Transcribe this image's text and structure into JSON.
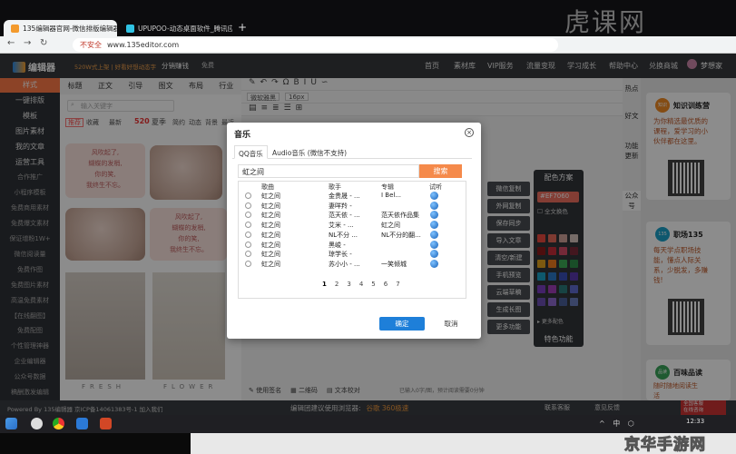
{
  "browser": {
    "tabs": [
      {
        "title": "135编辑器官网-微信排版编辑器",
        "active": true
      },
      {
        "title": "UPUPOO-动态桌面软件_腾讯应",
        "active": false
      }
    ],
    "new_tab": "+",
    "insecure_label": "不安全",
    "url": "www.135editor.com",
    "watermark_top": "虎课网"
  },
  "site_header": {
    "logo": "编辑器",
    "info": "520W式上架 | 好看好想动态字",
    "fans": "分销赚钱",
    "free": "免费",
    "nav": [
      "首页",
      "素材库",
      "VIP服务",
      "流量变现",
      "学习成长",
      "帮助中心",
      "兑换商城"
    ],
    "user": "梦想家"
  },
  "left_sidebar": {
    "items": [
      {
        "label": "样式",
        "strong": true,
        "active": true
      },
      {
        "label": "一键排版",
        "strong": true
      },
      {
        "label": "模板",
        "strong": true
      },
      {
        "label": "图片素材",
        "strong": true
      },
      {
        "label": "我的文章",
        "strong": true
      },
      {
        "label": "运营工具",
        "strong": true
      },
      {
        "label": "合作推广",
        "strong": false
      },
      {
        "label": "小程序模板",
        "strong": false
      },
      {
        "label": "免费商用素材",
        "strong": false
      },
      {
        "label": "免费爆文素材",
        "strong": false
      },
      {
        "label": "保证增粉1W+",
        "strong": false
      },
      {
        "label": "微信阅读量",
        "strong": false
      },
      {
        "label": "免费作图",
        "strong": false
      },
      {
        "label": "免费图片素材",
        "strong": false
      },
      {
        "label": "高温免费素材",
        "strong": false
      },
      {
        "label": "【在线翻图】",
        "strong": false
      },
      {
        "label": "免费配图",
        "strong": false
      },
      {
        "label": "个性管理神器",
        "strong": false
      },
      {
        "label": "企业编辑器",
        "strong": false
      },
      {
        "label": "公众号数据",
        "strong": false
      },
      {
        "label": "稿酬激发编辑",
        "strong": false
      }
    ]
  },
  "left_panel": {
    "tabs": [
      "标题",
      "正文",
      "引导",
      "图文",
      "布局",
      "行业"
    ],
    "search_placeholder": "输入关键字",
    "tags": {
      "a": "推荐",
      "b": "收藏",
      "c": "最新",
      "d": "520",
      "e": "夏季",
      "f": "简约",
      "g": "动态",
      "h": "背景",
      "i": "最近"
    },
    "card_text": "风吹起了,\n蝴蝶的发梢,\n你的笑,\n我终生不忘。",
    "card_text2": "风吹起了,\n蝴蝶的发梢,\n你的笑,\n我终生不忘。",
    "fresh": "FRESH",
    "flower": "FLOWER"
  },
  "editor": {
    "font_select": "微软雅黑",
    "size_select": "16px",
    "footer": [
      "使用签名",
      "二维码",
      "文本校对"
    ],
    "word_count": "已输入0字/图，预计阅读需要0分钟"
  },
  "side_actions": [
    "微信复制",
    "外网复制",
    "保存同步",
    "导入文章",
    "清空/新建",
    "手机预览",
    "云端草稿",
    "生成长图",
    "更多功能"
  ],
  "color_panel": {
    "title": "配色方案",
    "hex": "#EF7060",
    "all_label": "全文换色",
    "more": "更多配色",
    "func": "特色功能",
    "swatches": [
      "#e94a3f",
      "#e56b5a",
      "#cfa39a",
      "#d8c5bd",
      "#8b1a1a",
      "#c62c3a",
      "#d44b66",
      "#7a2a3a",
      "#e2a31e",
      "#ef7d1e",
      "#3cab56",
      "#2f8f4a",
      "#1aa2c7",
      "#2a78c6",
      "#3a4fb8",
      "#5a3ab0",
      "#7a3fbf",
      "#a03fb8",
      "#2a7a7a",
      "#5f6cd0",
      "#6c4fb2",
      "#8e6ad0",
      "#4a5f9a",
      "#6a7fbd"
    ]
  },
  "right_tabs": [
    "热点",
    "好文",
    "功能更新",
    "公众号"
  ],
  "promos": [
    {
      "title": "知识训练营",
      "badge": "知识",
      "text": "为你精选最优质的\n课程，爱学习的小\n伙伴都在这里。"
    },
    {
      "title": "职场135",
      "badge": "135",
      "text": "每天学点职场技\n能，懂点人际关\n系，少脱发，多赚\n钱!"
    },
    {
      "title": "百味品读",
      "badge": "品读",
      "text": "随时随地阅读生\n活"
    }
  ],
  "site_footer": {
    "powered": "Powered By 135编辑器  京ICP备14061383号-1  加入我们",
    "mid": "编辑团建议使用浏览器:",
    "browsers": "谷歌  360极速",
    "contact": "联系客服",
    "feedback": "意见反馈",
    "badge": "全国客服\n在线咨询"
  },
  "dialog": {
    "title": "音乐",
    "close": "×",
    "tabs": [
      "QQ音乐",
      "Audio音乐 (微信不支持)"
    ],
    "query": "虹之间",
    "search_label": "搜索",
    "headers": [
      "歌曲",
      "歌手",
      "专辑",
      "试听"
    ],
    "rows": [
      {
        "song": "虹之间",
        "singer": "金贵晟 - ...",
        "album": "I Bel..."
      },
      {
        "song": "虹之间",
        "singer": "妻咩羚 -",
        "album": ""
      },
      {
        "song": "虹之间",
        "singer": "范天依 - ...",
        "album": "范天依作品集"
      },
      {
        "song": "虹之间",
        "singer": "艾米 - ...",
        "album": "虹之间"
      },
      {
        "song": "虹之间",
        "singer": "NL不分 ...",
        "album": "NL不分的翻..."
      },
      {
        "song": "虹之间",
        "singer": "黑峻 -",
        "album": ""
      },
      {
        "song": "虹之间",
        "singer": "琼学长 -",
        "album": ""
      },
      {
        "song": "虹之间",
        "singer": "苏小小 - ...",
        "album": "一笑倾城"
      }
    ],
    "pages": [
      "1",
      "2",
      "3",
      "4",
      "5",
      "6",
      "7"
    ],
    "ok": "确定",
    "cancel": "取消"
  },
  "taskbar": {
    "time": "12:33",
    "tray": "^ 中 ⬡"
  },
  "watermark_bottom": "京华手游网"
}
